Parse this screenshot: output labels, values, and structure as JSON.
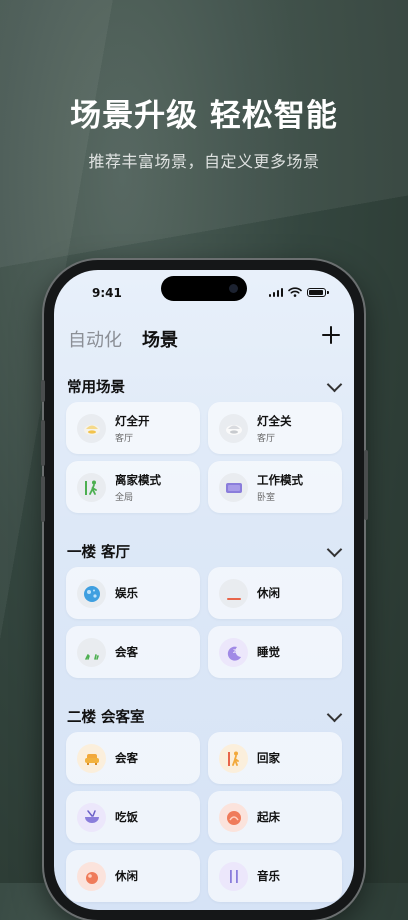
{
  "promo": {
    "headline": "场景升级 轻松智能",
    "subline": "推荐丰富场景，自定义更多场景"
  },
  "status_bar": {
    "time": "9:41"
  },
  "tabs": [
    {
      "label": "自动化",
      "active": false
    },
    {
      "label": "场景",
      "active": true
    }
  ],
  "sections": [
    {
      "title": "常用场景",
      "cards": [
        {
          "name": "灯全开",
          "room": "客厅",
          "icon": "lamp-on-icon"
        },
        {
          "name": "灯全关",
          "room": "客厅",
          "icon": "lamp-off-icon"
        },
        {
          "name": "离家模式",
          "room": "全局",
          "icon": "walking-person-icon"
        },
        {
          "name": "工作模式",
          "room": "卧室",
          "icon": "laptop-icon"
        }
      ]
    },
    {
      "title": "一楼 客厅",
      "cards": [
        {
          "name": "娱乐",
          "icon": "game-ball-icon"
        },
        {
          "name": "休闲",
          "icon": "relax-icon"
        },
        {
          "name": "会客",
          "icon": "plant-icon"
        },
        {
          "name": "睡觉",
          "icon": "moon-sleep-icon"
        }
      ]
    },
    {
      "title": "二楼 会客室",
      "cards": [
        {
          "name": "会客",
          "icon": "sofa-icon"
        },
        {
          "name": "回家",
          "icon": "door-person-icon"
        },
        {
          "name": "吃饭",
          "icon": "bowl-icon"
        },
        {
          "name": "起床",
          "icon": "sunrise-icon"
        },
        {
          "name": "休闲",
          "icon": "relax-icon"
        },
        {
          "name": "音乐",
          "icon": "music-icon"
        }
      ]
    }
  ],
  "colors": {
    "background": "#34463f",
    "screen_top": "#e8f0fa",
    "screen_bottom": "#d6e3f6",
    "accent_green": "#4caf50",
    "accent_purple": "#8a7ddb",
    "accent_orange": "#f2a93b",
    "accent_red": "#e8654a",
    "accent_blue": "#3f7ad6"
  }
}
